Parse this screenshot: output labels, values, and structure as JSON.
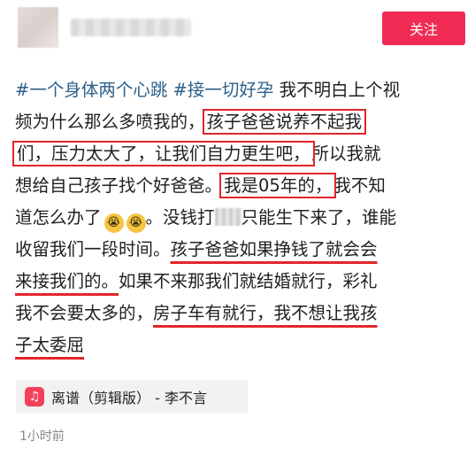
{
  "header": {
    "follow_label": "关注"
  },
  "post": {
    "lines": [
      [
        "#一个身体两个心跳 #接一切好孕",
        " 我不明白上个视"
      ],
      [
        "频为什么那么多喷我的，",
        "孩子爸爸说养不起我"
      ],
      [
        "们，压力太大了，让我们自力更生吧，",
        "所以我就"
      ],
      [
        "想给自己孩子找个好爸爸。",
        "我是05年的，",
        "我不知"
      ],
      [
        "道怎么办了",
        "。没钱打",
        "只能生下来了，谁能"
      ],
      [
        "收留我们一段时间。",
        "孩子爸爸如果挣钱了就会会"
      ],
      [
        "来接我们的。",
        "如果不来那我们就结婚就行，彩礼"
      ],
      [
        "我不会要太多的，",
        "房子车有就行，我不想让我孩"
      ],
      [
        "子太委屈"
      ]
    ]
  },
  "music": {
    "label": "离谱（剪辑版） - 李不言",
    "icon": "music-note-icon"
  },
  "timestamp": "1小时前",
  "colors": {
    "accent": "#f02c55",
    "highlight": "#e1262b",
    "hashtag": "#2b5f8a"
  }
}
